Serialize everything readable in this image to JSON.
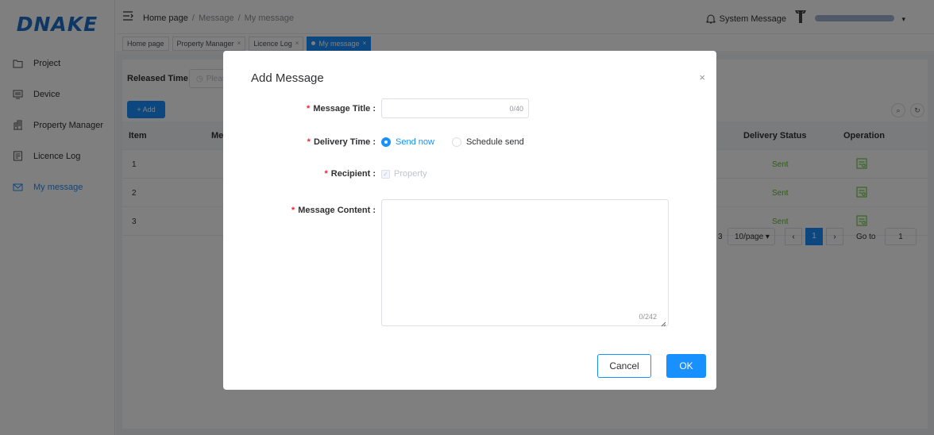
{
  "logo": "DNAKE",
  "sidebar": {
    "items": [
      {
        "label": "Project",
        "icon": "folder-icon"
      },
      {
        "label": "Device",
        "icon": "monitor-icon"
      },
      {
        "label": "Property Manager",
        "icon": "building-icon"
      },
      {
        "label": "Licence Log",
        "icon": "log-icon"
      },
      {
        "label": "My message",
        "icon": "mail-icon",
        "active": true
      }
    ]
  },
  "header": {
    "breadcrumb": [
      "Home page",
      "Message",
      "My message"
    ],
    "system_message": "System Message"
  },
  "tags": [
    {
      "label": "Home page"
    },
    {
      "label": "Property Manager",
      "close": "×"
    },
    {
      "label": "Licence Log",
      "close": "×"
    },
    {
      "label": "My message",
      "close": "×",
      "active": true
    }
  ],
  "main": {
    "filter_label": "Released Time",
    "filter_placeholder": "Please",
    "add_button": "+ Add",
    "columns": {
      "item": "Item",
      "message": "Me",
      "delivery_status": "Delivery Status",
      "operation": "Operation"
    },
    "rows": [
      {
        "item": "1",
        "status": "Sent"
      },
      {
        "item": "2",
        "status": "Sent"
      },
      {
        "item": "3",
        "status": "Sent"
      }
    ],
    "pager": {
      "total_fragment": "3",
      "page_size": "10/page",
      "current_page": "1",
      "goto_label": "Go to",
      "goto_value": "1"
    }
  },
  "dialog": {
    "title": "Add Message",
    "close": "×",
    "message_title_label": "Message Title :",
    "message_title_counter": "0/40",
    "delivery_time_label": "Delivery Time :",
    "send_now": "Send now",
    "schedule_send": "Schedule send",
    "recipient_label": "Recipient :",
    "recipient_option": "Property",
    "content_label": "Message Content :",
    "content_counter": "0/242",
    "required_mark": "*",
    "cancel": "Cancel",
    "ok": "OK"
  },
  "colors": {
    "primary": "#1890ff",
    "success": "#52c41a",
    "required": "#f5222d",
    "logo": "#1e6ec8"
  }
}
